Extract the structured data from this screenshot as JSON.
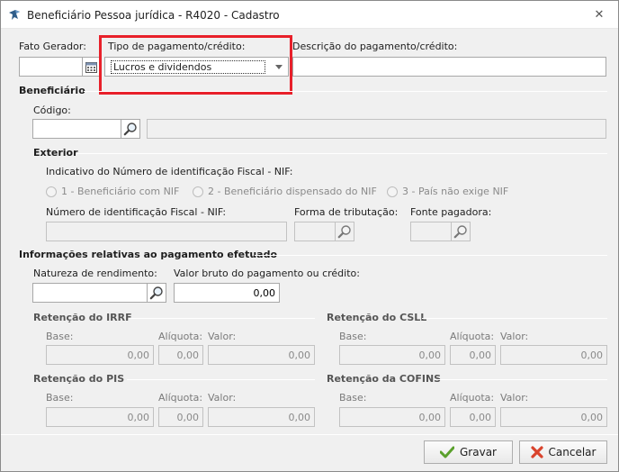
{
  "window": {
    "title": "Beneficiário Pessoa jurídica - R4020 - Cadastro",
    "close_glyph": "✕"
  },
  "header": {
    "fato_gerador_label": "Fato Gerador:",
    "fato_gerador_value": "",
    "tipo_label": "Tipo de pagamento/crédito:",
    "tipo_value": "Lucros e dividendos",
    "descricao_label": "Descrição do pagamento/crédito:",
    "descricao_value": ""
  },
  "beneficiario": {
    "section": "Beneficiário",
    "codigo_label": "Código:",
    "codigo_value": "",
    "nome_value": ""
  },
  "exterior": {
    "section": "Exterior",
    "nif_indicativo_label": "Indicativo do Número de identificação Fiscal - NIF:",
    "radios": [
      "1 - Beneficiário com NIF",
      "2 - Beneficiário dispensado do NIF",
      "3 - País não exige NIF"
    ],
    "nif_label": "Número de identificação Fiscal - NIF:",
    "forma_label": "Forma de tributação:",
    "fonte_label": "Fonte pagadora:"
  },
  "pagamento": {
    "section": "Informações relativas ao pagamento efetuado",
    "natureza_label": "Natureza de rendimento:",
    "natureza_value": "",
    "valor_bruto_label": "Valor bruto do pagamento ou crédito:",
    "valor_bruto_value": "0,00"
  },
  "retencoes": {
    "base_label": "Base:",
    "aliquota_label": "Alíquota:",
    "valor_label": "Valor:",
    "irrf": {
      "title": "Retenção do IRRF",
      "base": "0,00",
      "aliquota": "0,00",
      "valor": "0,00"
    },
    "csll": {
      "title": "Retenção do CSLL",
      "base": "0,00",
      "aliquota": "0,00",
      "valor": "0,00"
    },
    "pis": {
      "title": "Retenção do PIS",
      "base": "0,00",
      "aliquota": "0,00",
      "valor": "0,00"
    },
    "cofins": {
      "title": "Retenção da COFINS",
      "base": "0,00",
      "aliquota": "0,00",
      "valor": "0,00"
    }
  },
  "footer": {
    "save_label": "Gravar",
    "cancel_label": "Cancelar"
  },
  "colors": {
    "highlight": "#e8202a",
    "save_check": "#5aa02c",
    "cancel_x": "#d9432c"
  }
}
